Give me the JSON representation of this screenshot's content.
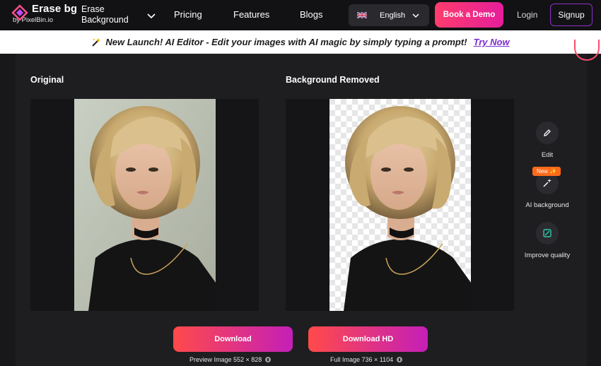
{
  "nav": {
    "logo_title": "Erase bg",
    "logo_sub": "by PixelBin.io",
    "product_line1": "Erase",
    "product_line2": "Background",
    "links": [
      "Pricing",
      "Features",
      "Blogs"
    ],
    "language": "English",
    "demo": "Book a Demo",
    "login": "Login",
    "signup": "Signup"
  },
  "banner": {
    "text": "New Launch! AI Editor - Edit your images with AI magic by simply typing a prompt!",
    "cta": "Try Now"
  },
  "panes": {
    "original_label": "Original",
    "removed_label": "Background Removed"
  },
  "tools": {
    "edit": "Edit",
    "ai_background": "AI background",
    "improve": "Improve quality",
    "new_badge": "New"
  },
  "downloads": {
    "download": "Download",
    "download_hd": "Download HD",
    "preview_note": "Preview Image 552 × 828",
    "full_note": "Full Image 736 × 1104"
  },
  "colors": {
    "accent_pink": "#ff3c6d",
    "accent_purple": "#7b2bd1",
    "badge_orange": "#ff6a1a"
  }
}
